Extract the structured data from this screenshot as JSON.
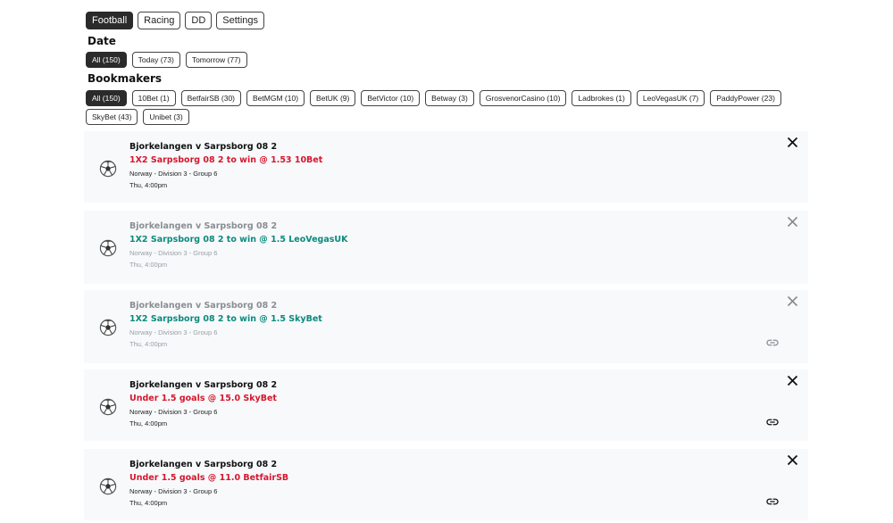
{
  "sport_tabs": [
    {
      "label": "Football",
      "active": true
    },
    {
      "label": "Racing",
      "active": false
    },
    {
      "label": "DD",
      "active": false
    },
    {
      "label": "Settings",
      "active": false
    }
  ],
  "date_heading": "Date",
  "date_tabs": [
    {
      "label": "All (150)",
      "active": true
    },
    {
      "label": "Today (73)",
      "active": false
    },
    {
      "label": "Tomorrow (77)",
      "active": false
    }
  ],
  "bookmakers_heading": "Bookmakers",
  "bookmakers": [
    {
      "label": "All (150)",
      "active": true
    },
    {
      "label": "10Bet (1)"
    },
    {
      "label": "BetfairSB (30)"
    },
    {
      "label": "BetMGM (10)"
    },
    {
      "label": "BetUK (9)"
    },
    {
      "label": "BetVictor (10)"
    },
    {
      "label": "Betway (3)"
    },
    {
      "label": "GrosvenorCasino (10)"
    },
    {
      "label": "Ladbrokes (1)"
    },
    {
      "label": "LeoVegasUK (7)"
    },
    {
      "label": "PaddyPower (23)"
    },
    {
      "label": "SkyBet (43)"
    },
    {
      "label": "Unibet (3)"
    }
  ],
  "cards": [
    {
      "title": "Bjorkelangen v Sarpsborg 08 2",
      "bet": "1X2 Sarpsborg 08 2 to win @ 1.53 10Bet",
      "league": "Norway - Division 3 - Group 6",
      "time": "Thu, 4:00pm",
      "bet_color": "#d6172d",
      "dimmed": false,
      "link": false
    },
    {
      "title": "Bjorkelangen v Sarpsborg 08 2",
      "bet": "1X2 Sarpsborg 08 2 to win @ 1.5 LeoVegasUK",
      "league": "Norway - Division 3 - Group 6",
      "time": "Thu, 4:00pm",
      "bet_color": "#0c8a7c",
      "dimmed": true,
      "link": false
    },
    {
      "title": "Bjorkelangen v Sarpsborg 08 2",
      "bet": "1X2 Sarpsborg 08 2 to win @ 1.5 SkyBet",
      "league": "Norway - Division 3 - Group 6",
      "time": "Thu, 4:00pm",
      "bet_color": "#0c8a7c",
      "dimmed": true,
      "link": true
    },
    {
      "title": "Bjorkelangen v Sarpsborg 08 2",
      "bet": "Under 1.5 goals @ 15.0 SkyBet",
      "league": "Norway - Division 3 - Group 6",
      "time": "Thu, 4:00pm",
      "bet_color": "#d6172d",
      "dimmed": false,
      "link": true
    },
    {
      "title": "Bjorkelangen v Sarpsborg 08 2",
      "bet": "Under 1.5 goals @ 11.0 BetfairSB",
      "league": "Norway - Division 3 - Group 6",
      "time": "Thu, 4:00pm",
      "bet_color": "#d6172d",
      "dimmed": false,
      "link": true
    }
  ],
  "icons": {
    "card_sport": "football-icon",
    "dismiss": "close-icon",
    "open": "link-icon"
  }
}
